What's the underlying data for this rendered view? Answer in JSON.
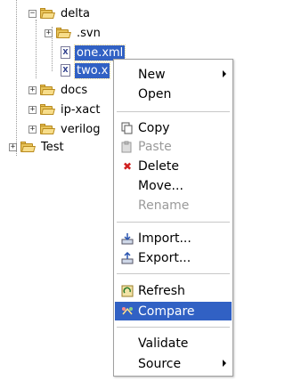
{
  "tree": {
    "delta": {
      "label": "delta"
    },
    "svn": {
      "label": ".svn"
    },
    "one_xml": {
      "label": "one.xml",
      "icon_text": "X"
    },
    "two_x": {
      "label": "two.x",
      "icon_text": "X"
    },
    "docs": {
      "label": "docs"
    },
    "ipxact": {
      "label": "ip-xact"
    },
    "verilog": {
      "label": "verilog"
    },
    "test": {
      "label": "Test"
    },
    "expander_plus": "+",
    "expander_minus": "−"
  },
  "menu": {
    "new": "New",
    "open": "Open",
    "copy": "Copy",
    "paste": "Paste",
    "delete": "Delete",
    "move": "Move...",
    "rename": "Rename",
    "import": "Import...",
    "export": "Export...",
    "refresh": "Refresh",
    "compare": "Compare",
    "validate": "Validate",
    "source": "Source"
  },
  "colors": {
    "selection": "#3161c4",
    "folder": "#e8c45a",
    "delete_icon": "#d02020"
  }
}
